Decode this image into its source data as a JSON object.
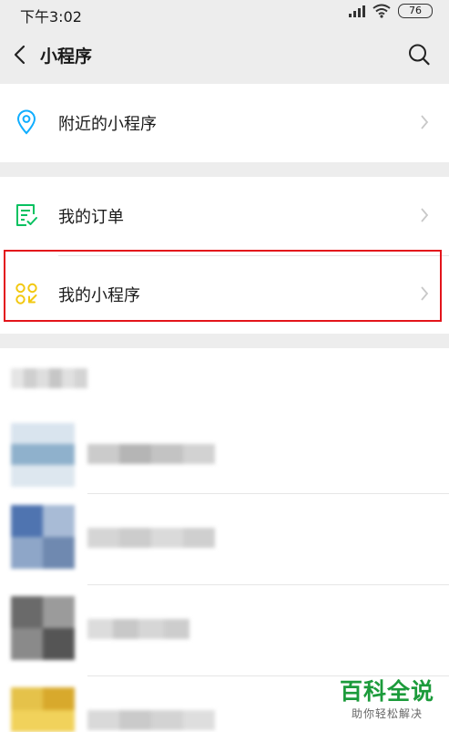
{
  "status_bar": {
    "time": "下午3:02",
    "battery": "76"
  },
  "nav": {
    "title": "小程序"
  },
  "menu": {
    "nearby": {
      "label": "附近的小程序"
    },
    "orders": {
      "label": "我的订单"
    },
    "my_mini_programs": {
      "label": "我的小程序"
    }
  },
  "colors": {
    "accent_teal": "#10aeff",
    "accent_green": "#07c160",
    "accent_yellow": "#f2c811",
    "highlight_border": "#e3141b",
    "watermark_green": "#1c9b3b"
  },
  "watermark": {
    "title": "百科全说",
    "subtitle": "助你轻松解决"
  }
}
